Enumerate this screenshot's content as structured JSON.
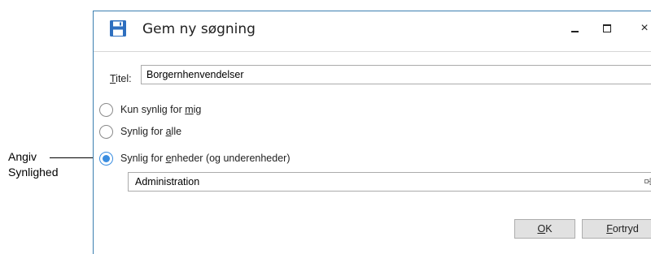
{
  "annotation": {
    "line1": "Angiv",
    "line2": "Synlighed"
  },
  "dialog": {
    "title": "Gem ny søgning",
    "icons": {
      "title": "save-disk-icon",
      "minimize": "minimize-icon",
      "maximize": "maximize-icon",
      "close": "close-icon"
    },
    "close_glyph": "×",
    "accent": "#2e6fbf",
    "title_field": {
      "label_first": "T",
      "label_rest": "itel:",
      "value": "Borgernhenvendelser"
    },
    "visibility": {
      "options": [
        {
          "pre": "Kun synlig for ",
          "mnemonic": "m",
          "post": "ig",
          "checked": false
        },
        {
          "pre": "Synlig for ",
          "mnemonic": "a",
          "post": "lle",
          "checked": false
        },
        {
          "pre": "Synlig for ",
          "mnemonic": "e",
          "post": "nheder (og underenheder)",
          "checked": true
        }
      ],
      "selected_color": "#3a8de0"
    },
    "unit_field": {
      "value": "Administration",
      "icon": "org-tree-icon"
    },
    "buttons": {
      "ok": {
        "mnemonic": "O",
        "rest": "K"
      },
      "cancel": {
        "mnemonic": "F",
        "rest": "ortryd"
      }
    }
  }
}
